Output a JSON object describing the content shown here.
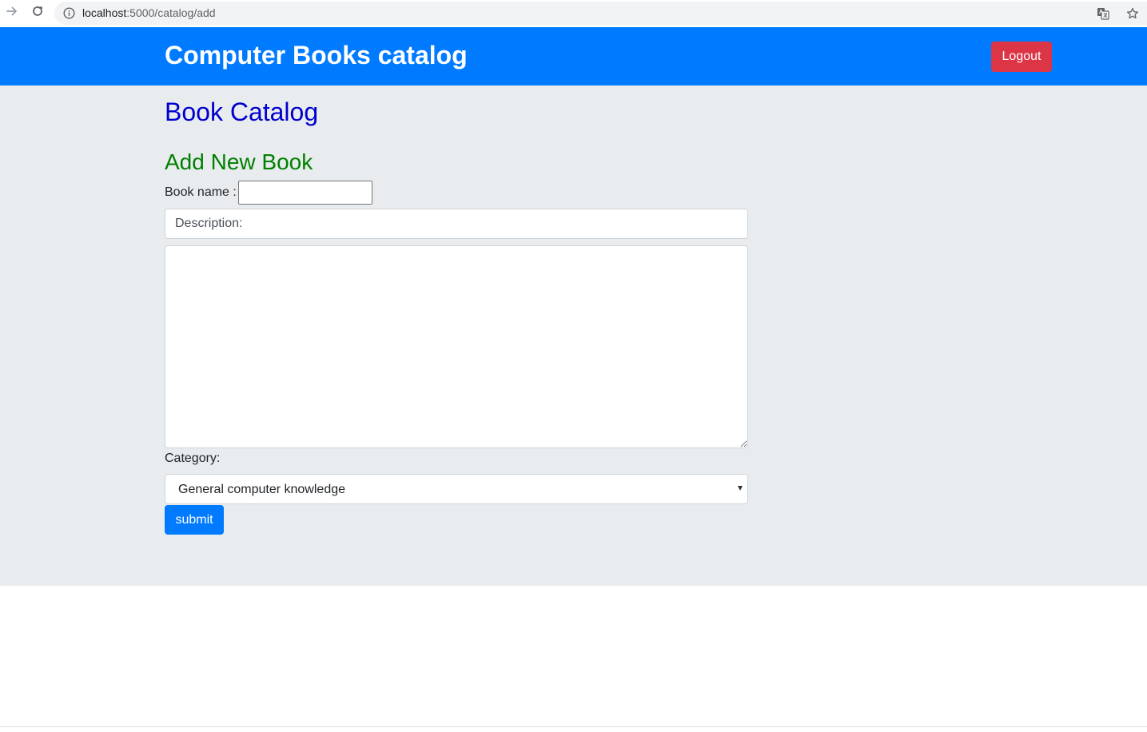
{
  "browser": {
    "url_host": "localhost",
    "url_path": ":5000/catalog/add"
  },
  "navbar": {
    "brand": "Computer Books catalog",
    "logout_label": "Logout"
  },
  "main": {
    "page_title": "Book Catalog",
    "form_title": "Add New Book",
    "book_name_label": "Book name :",
    "book_name_value": "",
    "description_placeholder": "Description:",
    "description_text": "",
    "category_label": "Category:",
    "category_selected": "General computer knowledge",
    "submit_label": "submit"
  },
  "colors": {
    "navbar_bg": "#007bff",
    "logout_bg": "#dc3545",
    "page_title": "#0000cd",
    "form_title": "#008000",
    "content_bg": "#e9ecef"
  },
  "icons": {
    "forward": "arrow-forward-icon",
    "reload": "reload-icon",
    "info": "info-icon",
    "translate": "translate-icon",
    "bookmark": "star-icon"
  }
}
